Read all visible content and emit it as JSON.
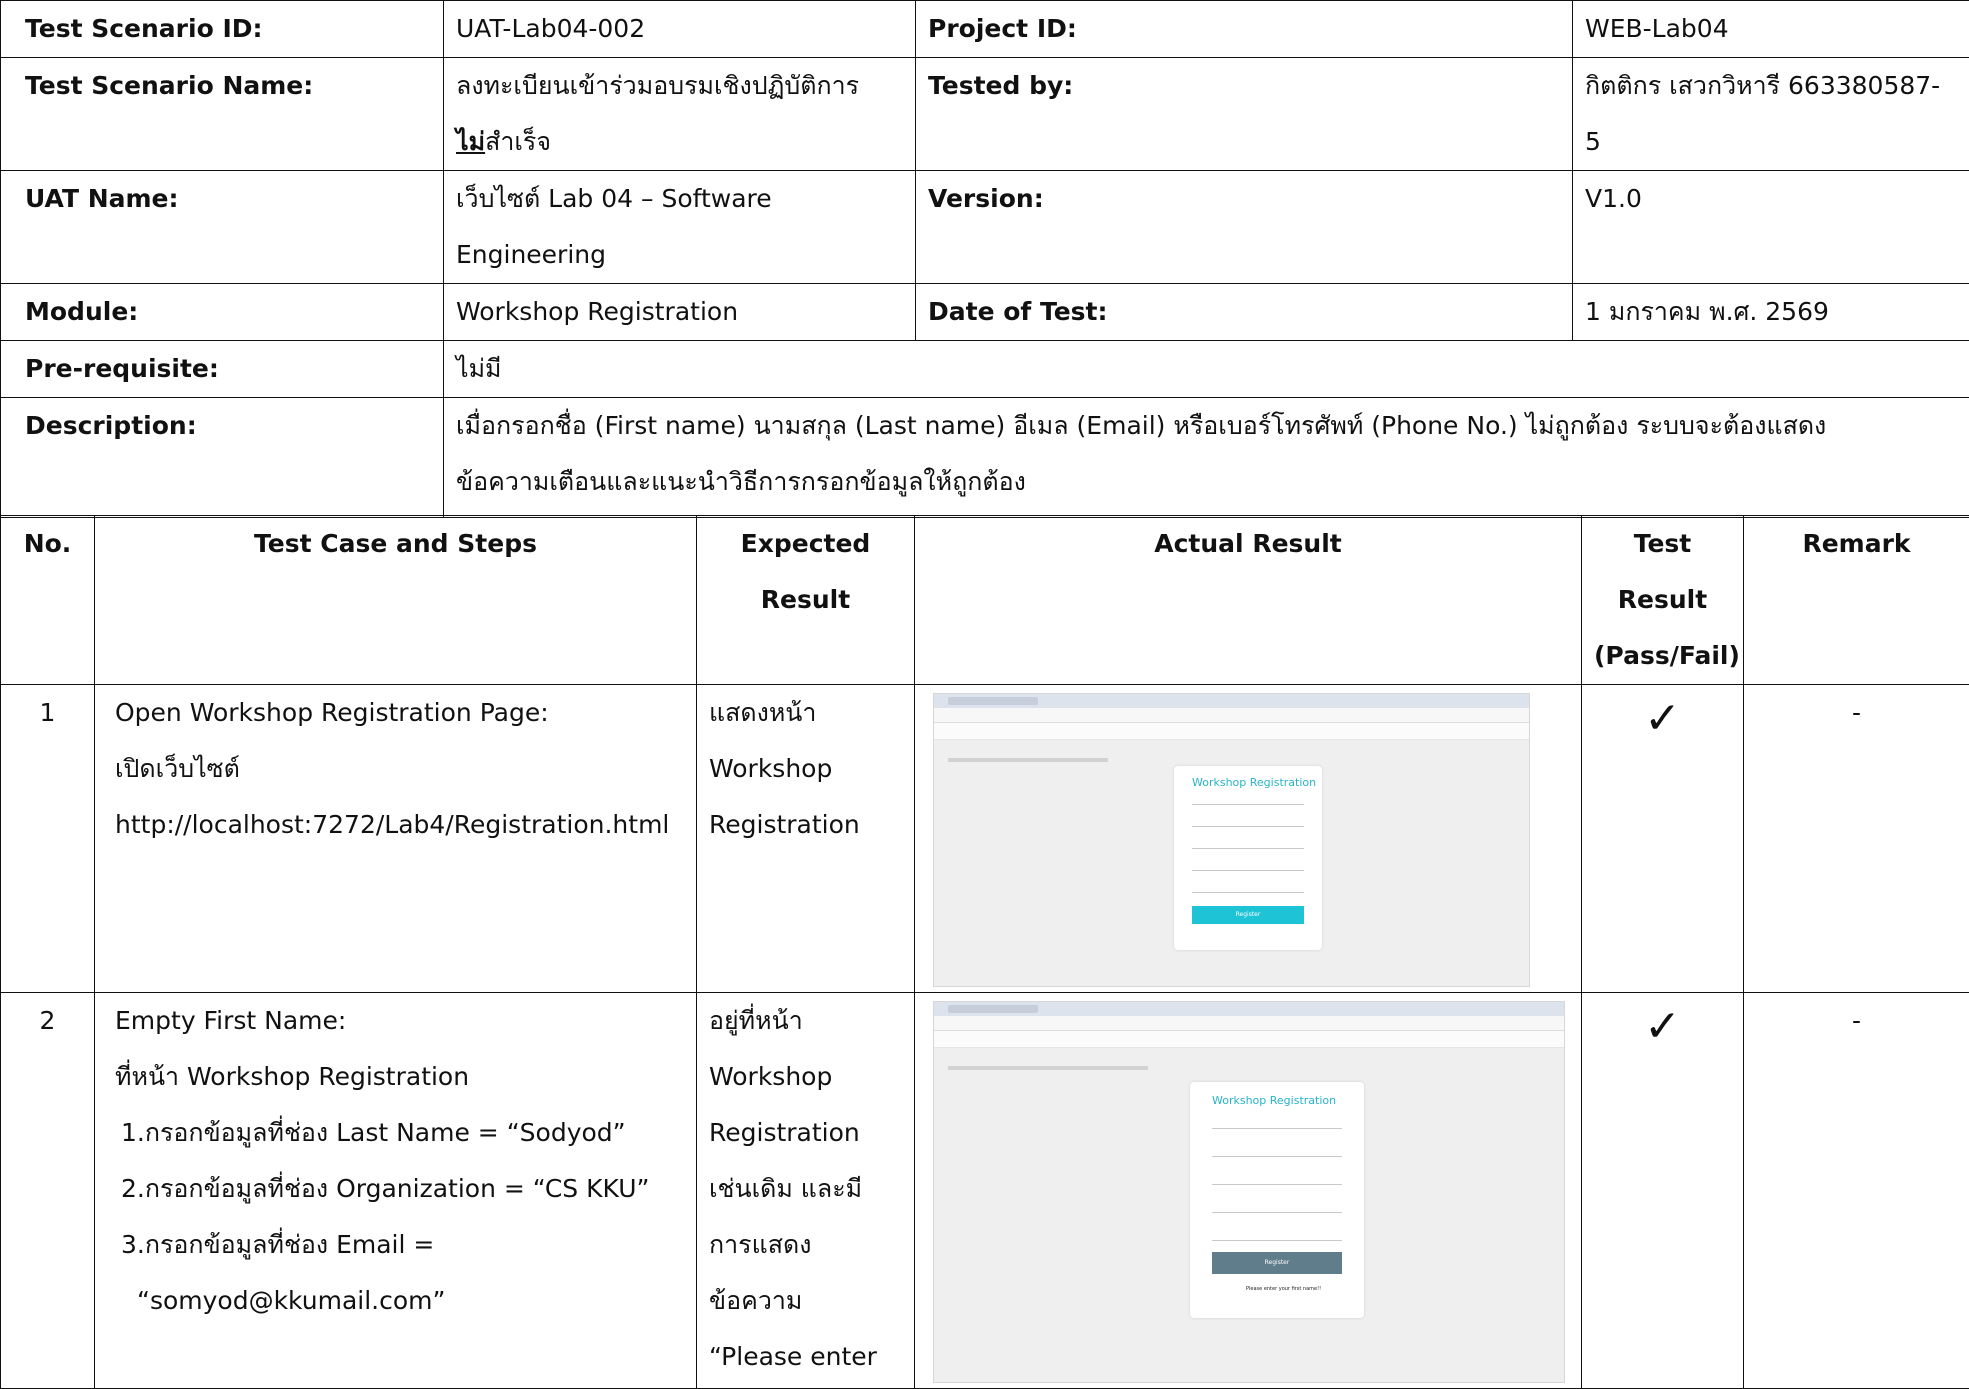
{
  "scenario": {
    "test_scenario_id_label": "Test Scenario ID:",
    "test_scenario_id": "UAT-Lab04-002",
    "project_id_label": "Project ID:",
    "project_id": "WEB-Lab04",
    "test_scenario_name_label": "Test Scenario Name:",
    "test_scenario_name_line1": "ลงทะเบียนเข้าร่วมอบรมเชิงปฏิบัติการ",
    "test_scenario_name_bold": "ไม่",
    "test_scenario_name_rest": "สำเร็จ",
    "tested_by_label": "Tested by:",
    "tested_by_line1": "กิตติกร เสวกวิหารี 663380587-",
    "tested_by_line2": "5",
    "uat_name_label": "UAT Name:",
    "uat_name_line1": "เว็บไซต์ Lab 04 – Software",
    "uat_name_line2": "Engineering",
    "version_label": "Version:",
    "version": "V1.0",
    "module_label": "Module:",
    "module": "Workshop Registration",
    "date_label": "Date of Test:",
    "date": "1 มกราคม พ.ศ. 2569",
    "prereq_label": "Pre-requisite:",
    "prereq": "ไม่มี",
    "description_label": "Description:",
    "description_line1": "เมื่อกรอกชื่อ (First name) นามสกุล (Last name) อีเมล (Email) หรือเบอร์โทรศัพท์ (Phone No.) ไม่ถูกต้อง ระบบจะต้องแสดง",
    "description_line2": "ข้อความเตือนและแนะนำวิธีการกรอกข้อมูลให้ถูกต้อง"
  },
  "columns": {
    "no": "No.",
    "steps": "Test Case and Steps",
    "expected_line1": "Expected",
    "expected_line2": "Result",
    "actual": "Actual Result",
    "test_line1": "Test",
    "test_line2": "Result",
    "test_line3": "(Pass/Fail)",
    "remark": "Remark"
  },
  "cases": [
    {
      "no": "1",
      "steps": [
        "Open Workshop Registration Page:",
        "เปิดเว็บไซต์",
        "http://localhost:7272/Lab4/Registration.html"
      ],
      "expected": [
        "แสดงหน้า",
        "Workshop",
        "Registration"
      ],
      "result_mark": "✓",
      "remark": "-",
      "screenshot": {
        "title": "Workshop Registration",
        "button": "Register"
      }
    },
    {
      "no": "2",
      "steps": [
        "Empty First Name:",
        "ที่หน้า Workshop Registration",
        "1.กรอกข้อมูลที่ช่อง Last Name = “Sodyod”",
        "2.กรอกข้อมูลที่ช่อง Organization = “CS KKU”",
        "3.กรอกข้อมูลที่ช่อง Email =",
        "“somyod@kkumail.com”"
      ],
      "expected": [
        "อยู่ที่หน้า",
        "Workshop",
        "Registration",
        "เช่นเดิม และมี",
        "การแสดง",
        "ข้อความ",
        "“Please enter"
      ],
      "result_mark": "✓",
      "remark": "-",
      "screenshot": {
        "title": "Workshop Registration",
        "button": "Register",
        "error": "Please enter your first name!!"
      }
    }
  ],
  "colors": {
    "border": "#111111",
    "shot_bg": "#efefef",
    "accent": "#27b3c9",
    "button_1": "#1fc3d6",
    "button_2": "#607d8b"
  }
}
